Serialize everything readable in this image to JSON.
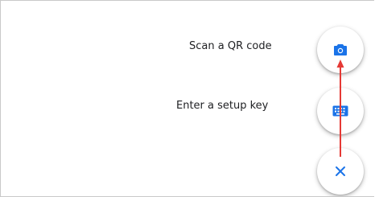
{
  "menu": {
    "items": [
      {
        "label": "Scan a QR code",
        "icon": "camera-icon"
      },
      {
        "label": "Enter a setup key",
        "icon": "keyboard-icon"
      }
    ],
    "close_icon": "close-icon"
  },
  "colors": {
    "accent": "#1a73e8",
    "annotation_arrow": "#e53935",
    "text": "#202124"
  }
}
